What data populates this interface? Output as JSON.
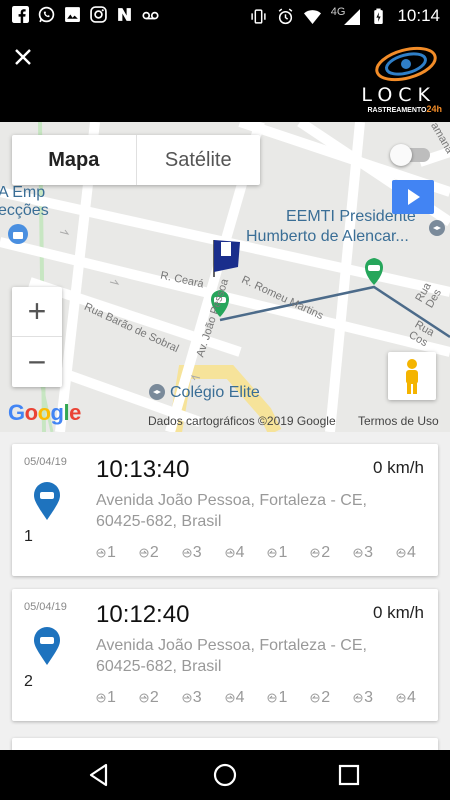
{
  "status_bar": {
    "time": "10:14",
    "network": "4G",
    "icons": [
      "facebook-icon",
      "whatsapp-icon",
      "gallery-icon",
      "instagram-icon",
      "n-icon",
      "voicemail-icon",
      "vibrate-icon",
      "alarm-icon",
      "wifi-icon",
      "signal-icon",
      "battery-charging-icon"
    ]
  },
  "app_bar": {
    "close_icon": "close-icon",
    "logo_text": "LOCK",
    "logo_sub": "RASTREAMENTO",
    "logo_sub_accent": "24h"
  },
  "map": {
    "type_tabs": [
      {
        "label": "Mapa",
        "selected": true
      },
      {
        "label": "Satélite",
        "selected": false
      }
    ],
    "zoom_in": "+",
    "zoom_out": "−",
    "google_logo": "Google",
    "attribution": "Dados cartográficos ©2019 Google",
    "terms": "Termos de Uso",
    "streets": [
      "R. Ceará",
      "R. Romeu Martins",
      "Rua Barão de Sobral",
      "Av. João Pessoa",
      "Rua Cos",
      "Rua Des",
      "amana"
    ],
    "pois": [
      "EEMTI Presidente",
      "Humberto de Alencar...",
      "Colégio Elite",
      "A Emp",
      "ecções"
    ],
    "flag_number": "1",
    "colors": {
      "route": "#4c6b8a",
      "marker": "#26a65b",
      "flag": "#1a2e8c",
      "play": "#4284f3"
    }
  },
  "records": [
    {
      "date": "05/04/19",
      "time": "10:13:40",
      "speed": "0 km/h",
      "address": "Avenida João Pessoa, Fortaleza - CE, 60425-682, Brasil",
      "index": "1",
      "io": [
        "1",
        "2",
        "3",
        "4",
        "1",
        "2",
        "3",
        "4"
      ]
    },
    {
      "date": "05/04/19",
      "time": "10:12:40",
      "speed": "0 km/h",
      "address": "Avenida João Pessoa, Fortaleza - CE, 60425-682, Brasil",
      "index": "2",
      "io": [
        "1",
        "2",
        "3",
        "4",
        "1",
        "2",
        "3",
        "4"
      ]
    }
  ],
  "nav_bar": {
    "icons": [
      "back-icon",
      "home-icon",
      "recents-icon"
    ]
  }
}
